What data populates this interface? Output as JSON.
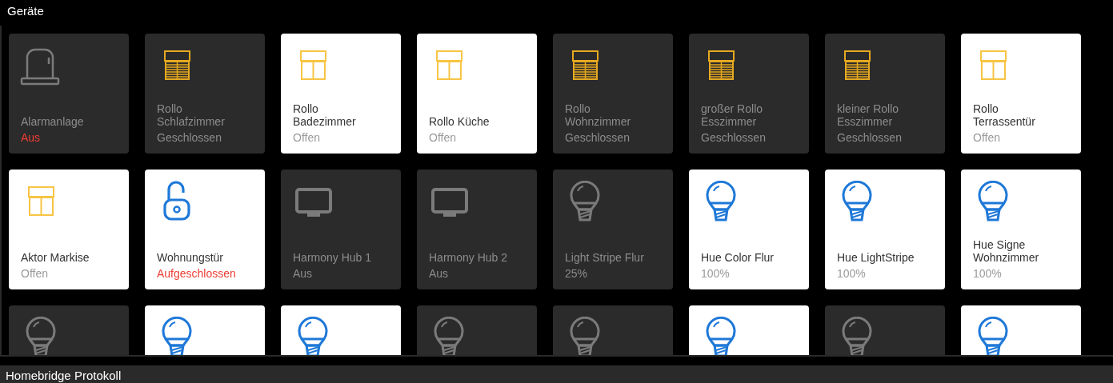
{
  "section": {
    "title": "Geräte"
  },
  "tiles": [
    {
      "kind": "alarm",
      "on": false,
      "name_lines": [
        "Alarmanlage"
      ],
      "status": "Aus",
      "alert": true
    },
    {
      "kind": "blind",
      "on": false,
      "name_lines": [
        "Rollo",
        "Schlafzimmer"
      ],
      "status": "Geschlossen",
      "alert": false
    },
    {
      "kind": "blind",
      "on": true,
      "name_lines": [
        "Rollo",
        "Badezimmer"
      ],
      "status": "Offen",
      "alert": false
    },
    {
      "kind": "blind",
      "on": true,
      "name_lines": [
        "Rollo Küche"
      ],
      "status": "Offen",
      "alert": false
    },
    {
      "kind": "blind",
      "on": false,
      "name_lines": [
        "Rollo",
        "Wohnzimmer"
      ],
      "status": "Geschlossen",
      "alert": false
    },
    {
      "kind": "blind",
      "on": false,
      "name_lines": [
        "großer Rollo",
        "Esszimmer"
      ],
      "status": "Geschlossen",
      "alert": false
    },
    {
      "kind": "blind",
      "on": false,
      "name_lines": [
        "kleiner Rollo",
        "Esszimmer"
      ],
      "status": "Geschlossen",
      "alert": false
    },
    {
      "kind": "blind",
      "on": true,
      "name_lines": [
        "Rollo",
        "Terrassentür"
      ],
      "status": "Offen",
      "alert": false
    },
    {
      "kind": "blind",
      "on": true,
      "name_lines": [
        "Aktor Markise"
      ],
      "status": "Offen",
      "alert": false
    },
    {
      "kind": "lock",
      "on": true,
      "name_lines": [
        "Wohnungstür"
      ],
      "status": "Aufgeschlossen",
      "alert": true
    },
    {
      "kind": "tv",
      "on": false,
      "name_lines": [
        "Harmony Hub 1"
      ],
      "status": "Aus",
      "alert": false
    },
    {
      "kind": "tv",
      "on": false,
      "name_lines": [
        "Harmony Hub 2"
      ],
      "status": "Aus",
      "alert": false
    },
    {
      "kind": "bulb",
      "on": false,
      "name_lines": [
        "Light Stripe Flur"
      ],
      "status": "25%",
      "alert": false
    },
    {
      "kind": "bulb",
      "on": true,
      "name_lines": [
        "Hue Color Flur"
      ],
      "status": "100%",
      "alert": false
    },
    {
      "kind": "bulb",
      "on": true,
      "name_lines": [
        "Hue LightStripe"
      ],
      "status": "100%",
      "alert": false
    },
    {
      "kind": "bulb",
      "on": true,
      "name_lines": [
        "Hue Signe",
        "Wohnzimmer"
      ],
      "status": "100%",
      "alert": false
    },
    {
      "kind": "bulb",
      "on": false
    },
    {
      "kind": "bulb",
      "on": true
    },
    {
      "kind": "bulb",
      "on": true
    },
    {
      "kind": "bulb",
      "on": false
    },
    {
      "kind": "bulb",
      "on": false
    },
    {
      "kind": "bulb",
      "on": true
    },
    {
      "kind": "bulb",
      "on": false
    },
    {
      "kind": "bulb",
      "on": true
    }
  ],
  "log_panel": {
    "title": "Homebridge Protokoll"
  }
}
